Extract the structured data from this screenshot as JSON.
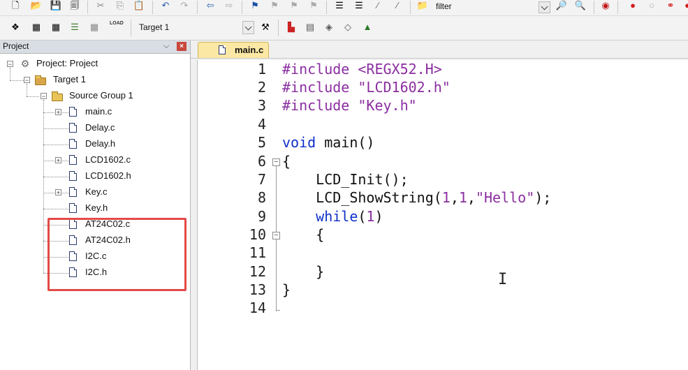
{
  "toolbar1": {
    "filter_value": "filter"
  },
  "toolbar2": {
    "load_label": "LOAD",
    "target_value": "Target 1"
  },
  "project_panel": {
    "title": "Project",
    "pin": "⌵",
    "close": "×",
    "tree": {
      "root": "Project: Project",
      "target": "Target 1",
      "group": "Source Group 1",
      "files": [
        {
          "name": "main.c",
          "expandable": true
        },
        {
          "name": "Delay.c",
          "expandable": false
        },
        {
          "name": "Delay.h",
          "expandable": false
        },
        {
          "name": "LCD1602.c",
          "expandable": true
        },
        {
          "name": "LCD1602.h",
          "expandable": false
        },
        {
          "name": "Key.c",
          "expandable": true
        },
        {
          "name": "Key.h",
          "expandable": false
        },
        {
          "name": "AT24C02.c",
          "expandable": false
        },
        {
          "name": "AT24C02.h",
          "expandable": false
        },
        {
          "name": "I2C.c",
          "expandable": false
        },
        {
          "name": "I2C.h",
          "expandable": false
        }
      ]
    }
  },
  "editor": {
    "tab_label": "main.c",
    "line_numbers": [
      "1",
      "2",
      "3",
      "4",
      "5",
      "6",
      "7",
      "8",
      "9",
      "10",
      "11",
      "12",
      "13",
      "14"
    ],
    "lines": {
      "l1_pp": "#include",
      "l1_arg": " <REGX52.H>",
      "l2_pp": "#include",
      "l2_arg": " \"LCD1602.h\"",
      "l3_pp": "#include",
      "l3_arg": " \"Key.h\"",
      "l5_kw": "void",
      "l5_rest": " main()",
      "l6": "{",
      "l7": "    LCD_Init();",
      "l8_a": "    LCD_ShowString(",
      "l8_n1": "1",
      "l8_c1": ",",
      "l8_n2": "1",
      "l8_c2": ",",
      "l8_s": "\"Hello\"",
      "l8_end": ");",
      "l9_kw": "    while",
      "l9_a": "(",
      "l9_n": "1",
      "l9_b": ")",
      "l10": "    {",
      "l12": "    }",
      "l13": "}"
    },
    "text_cursor": "I"
  },
  "colors": {
    "keyword": "#1030c8",
    "preprocessor": "#8a2ea0",
    "highlight_box": "#e44a47",
    "tab_active": "#fbe8a4"
  }
}
